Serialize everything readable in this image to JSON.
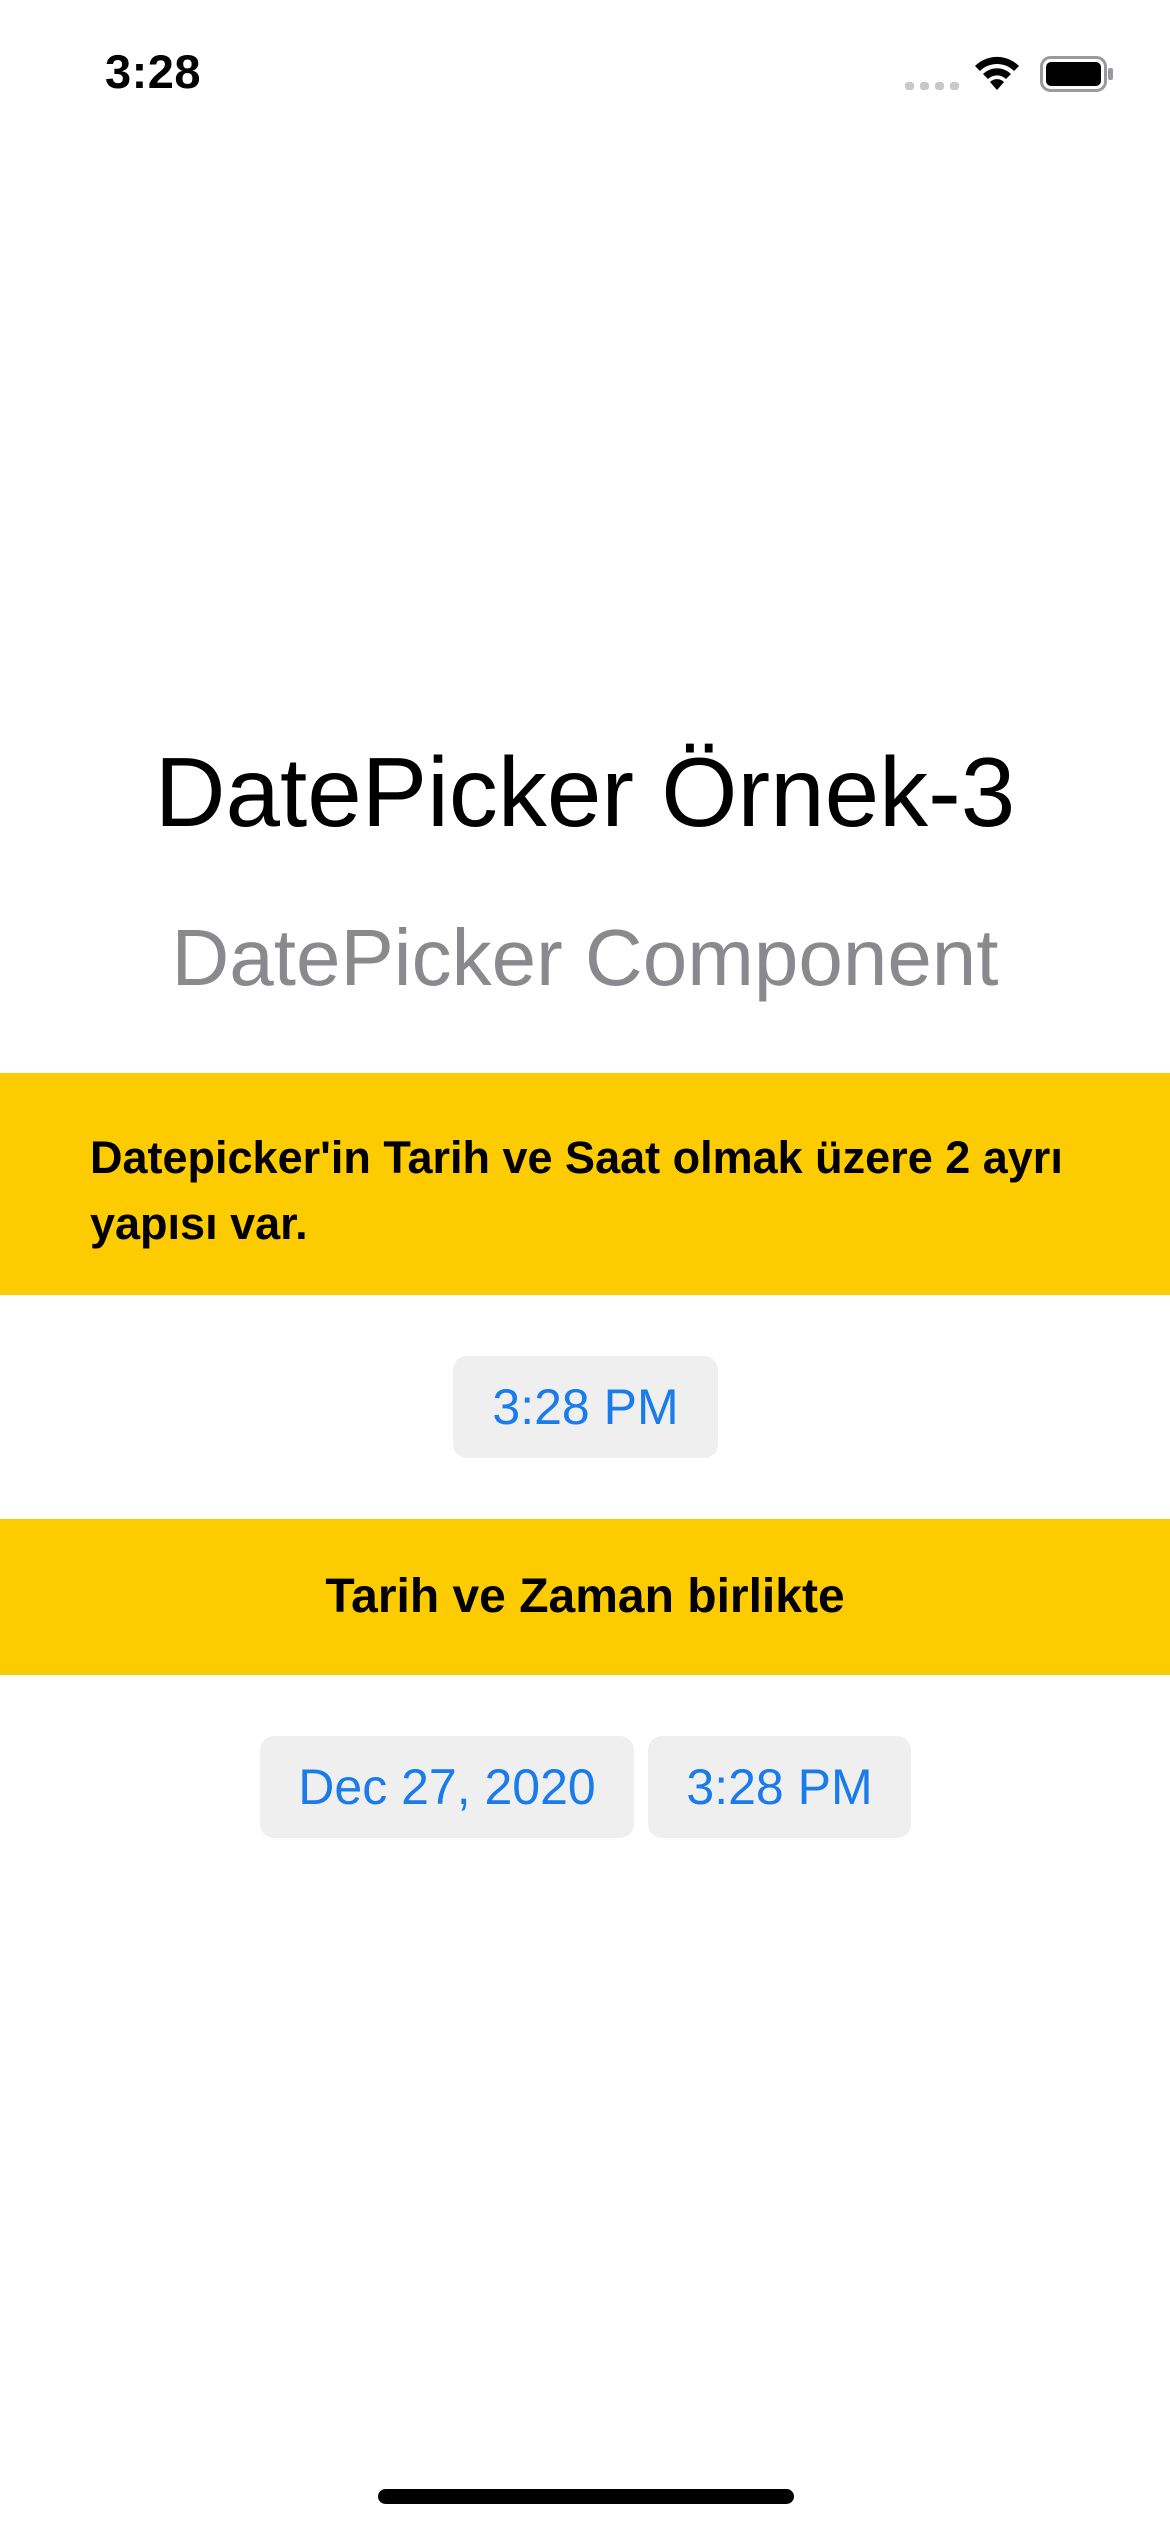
{
  "status_bar": {
    "time": "3:28",
    "icons": [
      "signal-icon",
      "wifi-icon",
      "battery-icon"
    ]
  },
  "header": {
    "title": "DatePicker Örnek-3",
    "subtitle": "DatePicker Component"
  },
  "banner_1": {
    "text": "Datepicker'in Tarih ve Saat olmak üzere 2 ayrı yapısı var."
  },
  "time_picker": {
    "value": "3:28 PM"
  },
  "banner_2": {
    "text": "Tarih ve Zaman birlikte"
  },
  "date_time_picker": {
    "date_value": "Dec 27, 2020",
    "time_value": "3:28 PM"
  },
  "colors": {
    "banner_background": "#fdcc00",
    "picker_text": "#1a7bea",
    "picker_background": "#efeff0",
    "subtitle_text": "#8a8a8e"
  }
}
